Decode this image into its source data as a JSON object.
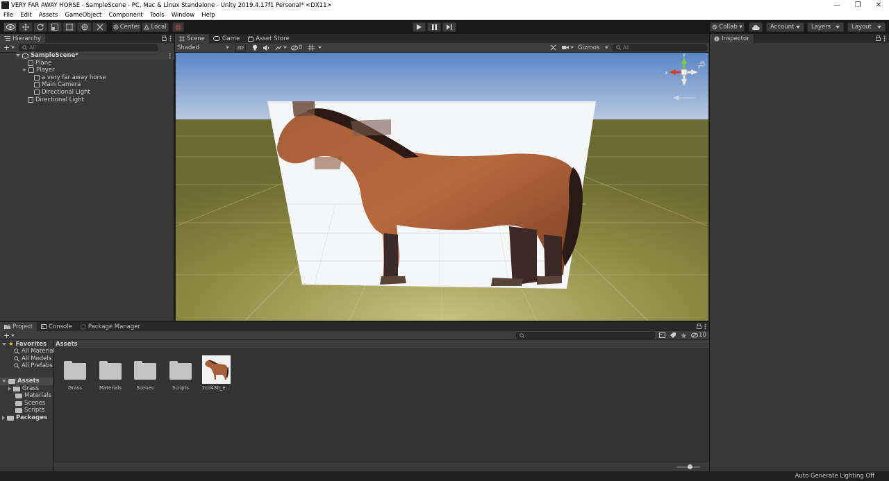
{
  "window": {
    "title": "VERY FAR AWAY HORSE - SampleScene - PC, Mac & Linux Standalone - Unity 2019.4.17f1 Personal* <DX11>",
    "controls": [
      "—",
      "❐",
      "✕"
    ]
  },
  "menu": [
    "File",
    "Edit",
    "Assets",
    "GameObject",
    "Component",
    "Tools",
    "Window",
    "Help"
  ],
  "toolbar": {
    "pivot_label": "Center",
    "space_label": "Local",
    "collab_label": "Collab ▾",
    "account_label": "Account",
    "layers_label": "Layers",
    "layout_label": "Layout"
  },
  "hierarchy": {
    "tab": "Hierarchy",
    "search_placeholder": "All",
    "items": [
      {
        "label": "SampleScene*"
      },
      {
        "label": "Plane"
      },
      {
        "label": "Player"
      },
      {
        "label": "a very far away horse"
      },
      {
        "label": "Main Camera"
      },
      {
        "label": "Directional Light"
      },
      {
        "label": "Directional Light"
      }
    ]
  },
  "scene_view": {
    "tabs": [
      "Scene",
      "Game",
      "Asset Store"
    ],
    "shading": "Shaded",
    "mode_2d": "2D",
    "hidden_count": "0",
    "gizmos": "Gizmos",
    "search_placeholder": "All",
    "gizmo_axes": {
      "y": "y",
      "x": "x",
      "z": "z"
    },
    "colors": {
      "sky_top": "#5b86c6",
      "sky_bottom": "#b3c6df",
      "ground": "#6b6a30",
      "ground_far": "#9c9a55"
    }
  },
  "inspector": {
    "tab": "Inspector"
  },
  "project": {
    "tabs": [
      "Project",
      "Console",
      "Package Manager"
    ],
    "visible_count": "10",
    "sidebar": {
      "favorites": "Favorites",
      "favorites_items": [
        "All Materials",
        "All Models",
        "All Prefabs"
      ],
      "assets": "Assets",
      "assets_items": [
        "Grass",
        "Materials",
        "Scenes",
        "Scripts"
      ],
      "packages": "Packages"
    },
    "breadcrumb": "Assets",
    "assets": [
      {
        "label": "Grass",
        "type": "folder"
      },
      {
        "label": "Materials",
        "type": "folder"
      },
      {
        "label": "Scenes",
        "type": "folder"
      },
      {
        "label": "Scripts",
        "type": "folder"
      },
      {
        "label": "2cd43b_e...",
        "type": "image"
      }
    ]
  },
  "status": {
    "text": "Auto Generate Lighting Off"
  }
}
